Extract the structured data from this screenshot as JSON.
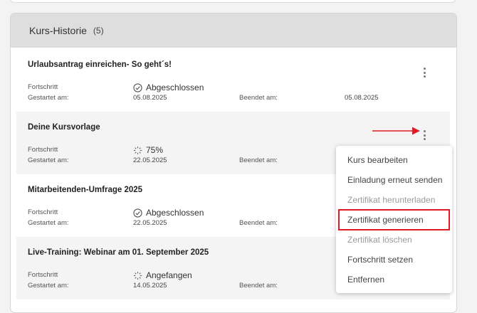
{
  "history": {
    "title": "Kurs-Historie",
    "count": "(5)",
    "labels": {
      "progress": "Fortschritt",
      "started": "Gestartet am:",
      "ended": "Beendet am:"
    },
    "courses": [
      {
        "title": "Urlaubsantrag einreichen- So geht´s!",
        "status": "Abgeschlossen",
        "status_icon": "check-circle-icon",
        "started": "05.08.2025",
        "ended": "05.08.2025"
      },
      {
        "title": "Deine Kursvorlage",
        "status": "75%",
        "status_icon": "spinner-icon",
        "started": "22.05.2025",
        "ended": ""
      },
      {
        "title": "Mitarbeitenden-Umfrage 2025",
        "status": "Abgeschlossen",
        "status_icon": "check-circle-icon",
        "started": "22.05.2025",
        "ended": ""
      },
      {
        "title": "Live-Training: Webinar am 01. September 2025",
        "status": "Angefangen",
        "status_icon": "spinner-icon",
        "started": "14.05.2025",
        "ended": ""
      }
    ]
  },
  "context_menu": {
    "items": [
      {
        "label": "Kurs bearbeiten",
        "disabled": false
      },
      {
        "label": "Einladung erneut senden",
        "disabled": false
      },
      {
        "label": "Zertifikat herunterladen",
        "disabled": true
      },
      {
        "label": "Zertifikat generieren",
        "disabled": false,
        "highlighted": true
      },
      {
        "label": "Zertifikat löschen",
        "disabled": true
      },
      {
        "label": "Fortschritt setzen",
        "disabled": false
      },
      {
        "label": "Entfernen",
        "disabled": false
      }
    ]
  },
  "colors": {
    "highlight": "#e01b24",
    "arrow": "#e01b24",
    "header_bg": "#dedede"
  }
}
